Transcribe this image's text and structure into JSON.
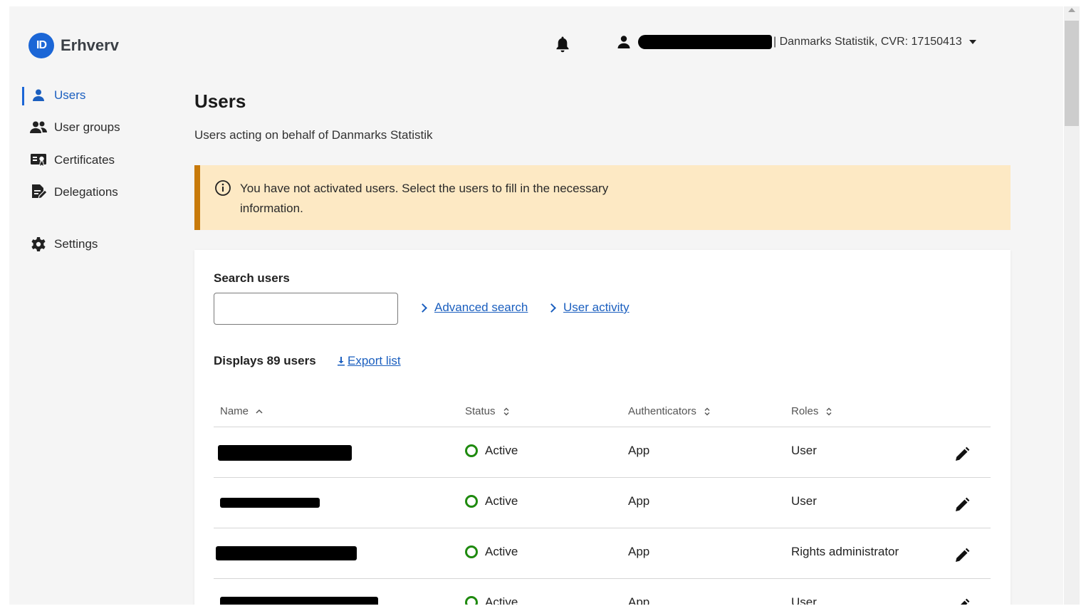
{
  "header": {
    "logo_badge": "ID",
    "logo_text": "Erhverv",
    "account_text": "| Danmarks Statistik, CVR: 17150413"
  },
  "sidebar": {
    "items": [
      {
        "label": "Users",
        "icon": "user-icon",
        "active": true
      },
      {
        "label": "User groups",
        "icon": "user-group-icon",
        "active": false
      },
      {
        "label": "Certificates",
        "icon": "certificate-icon",
        "active": false
      },
      {
        "label": "Delegations",
        "icon": "delegation-icon",
        "active": false
      },
      {
        "label": "Settings",
        "icon": "gear-icon",
        "active": false
      }
    ]
  },
  "main": {
    "title": "Users",
    "subtitle": "Users acting on behalf of Danmarks Statistik",
    "alert": "You have not activated users. Select the users to fill in the necessary information.",
    "search": {
      "label": "Search users",
      "placeholder": "",
      "value": ""
    },
    "links": {
      "advanced_search": "Advanced search",
      "user_activity": "User activity"
    },
    "count_text": "Displays 89 users",
    "export_label": "Export list",
    "table": {
      "columns": [
        "Name",
        "Status",
        "Authenticators",
        "Roles"
      ],
      "rows": [
        {
          "status": "Active",
          "authenticator": "App",
          "role": "User"
        },
        {
          "status": "Active",
          "authenticator": "App",
          "role": "User"
        },
        {
          "status": "Active",
          "authenticator": "App",
          "role": "Rights administrator"
        },
        {
          "status": "Active",
          "authenticator": "App",
          "role": "User"
        }
      ]
    }
  },
  "colors": {
    "accent": "#1b66d6",
    "alert_bg": "#fde9c4",
    "alert_border": "#c87a0a",
    "status_active": "#1f8a0f"
  }
}
